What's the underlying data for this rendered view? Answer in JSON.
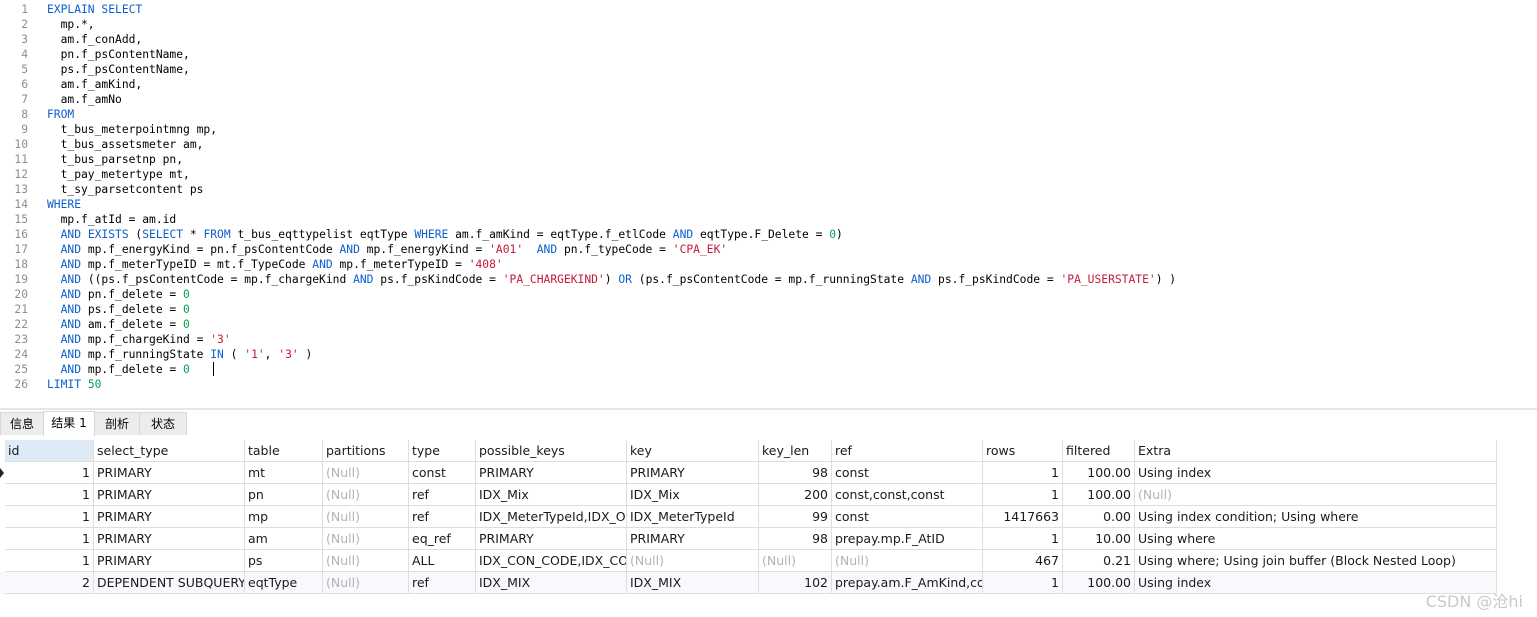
{
  "editor": {
    "lines": [
      {
        "n": "1",
        "t": [
          {
            "k": "kw",
            "v": "EXPLAIN SELECT"
          }
        ]
      },
      {
        "n": "2",
        "t": [
          {
            "k": "id",
            "v": "  mp.*,"
          }
        ]
      },
      {
        "n": "3",
        "t": [
          {
            "k": "id",
            "v": "  am.f_conAdd,"
          }
        ]
      },
      {
        "n": "4",
        "t": [
          {
            "k": "id",
            "v": "  pn.f_psContentName,"
          }
        ]
      },
      {
        "n": "5",
        "t": [
          {
            "k": "id",
            "v": "  ps.f_psContentName,"
          }
        ]
      },
      {
        "n": "6",
        "t": [
          {
            "k": "id",
            "v": "  am.f_amKind,"
          }
        ]
      },
      {
        "n": "7",
        "t": [
          {
            "k": "id",
            "v": "  am.f_amNo"
          }
        ]
      },
      {
        "n": "8",
        "t": [
          {
            "k": "kw",
            "v": "FROM"
          }
        ]
      },
      {
        "n": "9",
        "t": [
          {
            "k": "id",
            "v": "  t_bus_meterpointmng mp,"
          }
        ]
      },
      {
        "n": "10",
        "t": [
          {
            "k": "id",
            "v": "  t_bus_assetsmeter am,"
          }
        ]
      },
      {
        "n": "11",
        "t": [
          {
            "k": "id",
            "v": "  t_bus_parsetnp pn,"
          }
        ]
      },
      {
        "n": "12",
        "t": [
          {
            "k": "id",
            "v": "  t_pay_metertype mt,"
          }
        ]
      },
      {
        "n": "13",
        "t": [
          {
            "k": "id",
            "v": "  t_sy_parsetcontent ps"
          }
        ]
      },
      {
        "n": "14",
        "t": [
          {
            "k": "kw",
            "v": "WHERE"
          }
        ]
      },
      {
        "n": "15",
        "t": [
          {
            "k": "id",
            "v": "  mp.f_atId = am.id"
          }
        ]
      },
      {
        "n": "16",
        "t": [
          {
            "k": "id",
            "v": "  "
          },
          {
            "k": "kw",
            "v": "AND EXISTS"
          },
          {
            "k": "id",
            "v": " ("
          },
          {
            "k": "kw",
            "v": "SELECT"
          },
          {
            "k": "id",
            "v": " * "
          },
          {
            "k": "kw",
            "v": "FROM"
          },
          {
            "k": "id",
            "v": " t_bus_eqttypelist eqtType "
          },
          {
            "k": "kw",
            "v": "WHERE"
          },
          {
            "k": "id",
            "v": " am.f_amKind = eqtType.f_etlCode "
          },
          {
            "k": "kw",
            "v": "AND"
          },
          {
            "k": "id",
            "v": " eqtType.F_Delete = "
          },
          {
            "k": "num",
            "v": "0"
          },
          {
            "k": "id",
            "v": ")"
          }
        ]
      },
      {
        "n": "17",
        "t": [
          {
            "k": "id",
            "v": "  "
          },
          {
            "k": "kw",
            "v": "AND"
          },
          {
            "k": "id",
            "v": " mp.f_energyKind = pn.f_psContentCode "
          },
          {
            "k": "kw",
            "v": "AND"
          },
          {
            "k": "id",
            "v": " mp.f_energyKind = "
          },
          {
            "k": "str",
            "v": "'A01'"
          },
          {
            "k": "id",
            "v": "  "
          },
          {
            "k": "kw",
            "v": "AND"
          },
          {
            "k": "id",
            "v": " pn.f_typeCode = "
          },
          {
            "k": "str",
            "v": "'CPA_EK'"
          }
        ]
      },
      {
        "n": "18",
        "t": [
          {
            "k": "id",
            "v": "  "
          },
          {
            "k": "kw",
            "v": "AND"
          },
          {
            "k": "id",
            "v": " mp.f_meterTypeID = mt.f_TypeCode "
          },
          {
            "k": "kw",
            "v": "AND"
          },
          {
            "k": "id",
            "v": " mp.f_meterTypeID = "
          },
          {
            "k": "str",
            "v": "'408'"
          }
        ]
      },
      {
        "n": "19",
        "t": [
          {
            "k": "id",
            "v": "  "
          },
          {
            "k": "kw",
            "v": "AND"
          },
          {
            "k": "id",
            "v": " ((ps.f_psContentCode = mp.f_chargeKind "
          },
          {
            "k": "kw",
            "v": "AND"
          },
          {
            "k": "id",
            "v": " ps.f_psKindCode = "
          },
          {
            "k": "str",
            "v": "'PA_CHARGEKIND'"
          },
          {
            "k": "id",
            "v": ") "
          },
          {
            "k": "kw",
            "v": "OR"
          },
          {
            "k": "id",
            "v": " (ps.f_psContentCode = mp.f_runningState "
          },
          {
            "k": "kw",
            "v": "AND"
          },
          {
            "k": "id",
            "v": " ps.f_psKindCode = "
          },
          {
            "k": "str",
            "v": "'PA_USERSTATE'"
          },
          {
            "k": "id",
            "v": ") )"
          }
        ]
      },
      {
        "n": "20",
        "t": [
          {
            "k": "id",
            "v": "  "
          },
          {
            "k": "kw",
            "v": "AND"
          },
          {
            "k": "id",
            "v": " pn.f_delete = "
          },
          {
            "k": "num",
            "v": "0"
          }
        ]
      },
      {
        "n": "21",
        "t": [
          {
            "k": "id",
            "v": "  "
          },
          {
            "k": "kw",
            "v": "AND"
          },
          {
            "k": "id",
            "v": " ps.f_delete = "
          },
          {
            "k": "num",
            "v": "0"
          }
        ]
      },
      {
        "n": "22",
        "t": [
          {
            "k": "id",
            "v": "  "
          },
          {
            "k": "kw",
            "v": "AND"
          },
          {
            "k": "id",
            "v": " am.f_delete = "
          },
          {
            "k": "num",
            "v": "0"
          }
        ]
      },
      {
        "n": "23",
        "t": [
          {
            "k": "id",
            "v": "  "
          },
          {
            "k": "kw",
            "v": "AND"
          },
          {
            "k": "id",
            "v": " mp.f_chargeKind = "
          },
          {
            "k": "str",
            "v": "'3'"
          }
        ]
      },
      {
        "n": "24",
        "t": [
          {
            "k": "id",
            "v": "  "
          },
          {
            "k": "kw",
            "v": "AND"
          },
          {
            "k": "id",
            "v": " mp.f_runningState "
          },
          {
            "k": "kw",
            "v": "IN"
          },
          {
            "k": "id",
            "v": " ( "
          },
          {
            "k": "str",
            "v": "'1'"
          },
          {
            "k": "id",
            "v": ", "
          },
          {
            "k": "str",
            "v": "'3'"
          },
          {
            "k": "id",
            "v": " )"
          }
        ]
      },
      {
        "n": "25",
        "t": [
          {
            "k": "id",
            "v": "  "
          },
          {
            "k": "kw",
            "v": "AND"
          },
          {
            "k": "id",
            "v": " mp.f_delete = "
          },
          {
            "k": "num",
            "v": "0"
          }
        ]
      },
      {
        "n": "26",
        "t": [
          {
            "k": "kw",
            "v": "LIMIT"
          },
          {
            "k": "id",
            "v": " "
          },
          {
            "k": "num",
            "v": "50"
          }
        ]
      }
    ]
  },
  "tabs": {
    "info": "信息",
    "result1": "结果 1",
    "profile": "剖析",
    "status": "状态"
  },
  "grid": {
    "columns": [
      "id",
      "select_type",
      "table",
      "partitions",
      "type",
      "possible_keys",
      "key",
      "key_len",
      "ref",
      "rows",
      "filtered",
      "Extra"
    ],
    "rows": [
      [
        "1",
        "PRIMARY",
        "mt",
        "(Null)",
        "const",
        "PRIMARY",
        "PRIMARY",
        "98",
        "const",
        "1",
        "100.00",
        "Using index"
      ],
      [
        "1",
        "PRIMARY",
        "pn",
        "(Null)",
        "ref",
        "IDX_Mix",
        "IDX_Mix",
        "200",
        "const,const,const",
        "1",
        "100.00",
        "(Null)"
      ],
      [
        "1",
        "PRIMARY",
        "mp",
        "(Null)",
        "ref",
        "IDX_MeterTypeId,IDX_Op",
        "IDX_MeterTypeId",
        "99",
        "const",
        "1417663",
        "0.00",
        "Using index condition; Using where"
      ],
      [
        "1",
        "PRIMARY",
        "am",
        "(Null)",
        "eq_ref",
        "PRIMARY",
        "PRIMARY",
        "98",
        "prepay.mp.F_AtID",
        "1",
        "10.00",
        "Using where"
      ],
      [
        "1",
        "PRIMARY",
        "ps",
        "(Null)",
        "ALL",
        "IDX_CON_CODE,IDX_COD",
        "(Null)",
        "(Null)",
        "(Null)",
        "467",
        "0.21",
        "Using where; Using join buffer (Block Nested Loop)"
      ],
      [
        "2",
        "DEPENDENT SUBQUERY",
        "eqtType",
        "(Null)",
        "ref",
        "IDX_MIX",
        "IDX_MIX",
        "102",
        "prepay.am.F_AmKind,cons",
        "1",
        "100.00",
        "Using index"
      ]
    ]
  },
  "watermark": "CSDN @沧hi",
  "colors": {
    "keyword": "#0b5fd0",
    "string": "#c41a3a",
    "number": "#07a14a",
    "null": "#b3b3b3"
  }
}
